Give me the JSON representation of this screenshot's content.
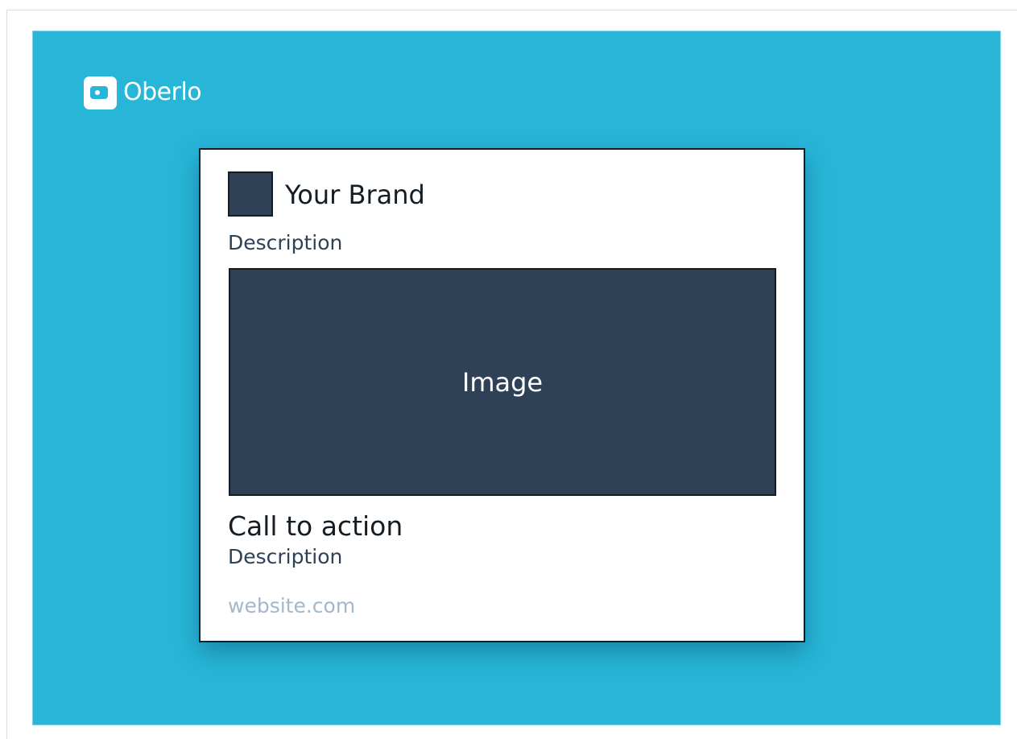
{
  "logo": {
    "text": "Oberlo",
    "icon": "price-tag-icon"
  },
  "card": {
    "brand_name": "Your Brand",
    "description_top": "Description",
    "image_label": "Image",
    "call_to_action": "Call to action",
    "description_bottom": "Description",
    "website": "website.com"
  },
  "colors": {
    "background": "#27b6d8",
    "card": "#ffffff",
    "placeholder": "#2e4157",
    "border": "#141c24",
    "website_text": "#a3b8cc"
  }
}
